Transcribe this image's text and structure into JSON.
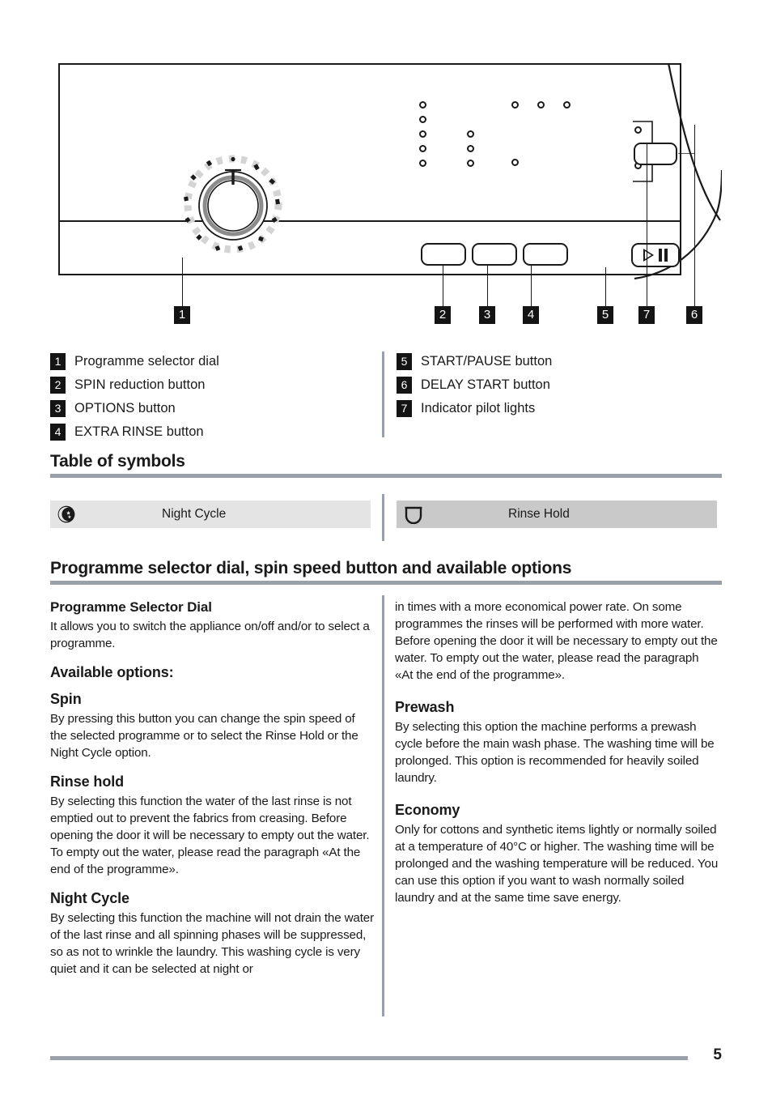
{
  "diagram": {
    "callouts": [
      {
        "num": "1"
      },
      {
        "num": "2"
      },
      {
        "num": "3"
      },
      {
        "num": "4"
      },
      {
        "num": "5"
      },
      {
        "num": "7"
      },
      {
        "num": "6"
      }
    ],
    "icons": {
      "dial": "programme-selector-dial-icon",
      "start_pause": "play-pause-icon",
      "delay_start": "delay-start-button-icon",
      "indicator_lights": "indicator-pilot-lights-icon"
    }
  },
  "legend": {
    "left": [
      {
        "num": "1",
        "label": "Programme selector dial"
      },
      {
        "num": "2",
        "label": "SPIN reduction button"
      },
      {
        "num": "3",
        "label": "OPTIONS button"
      },
      {
        "num": "4",
        "label": "EXTRA RINSE button"
      }
    ],
    "right": [
      {
        "num": "5",
        "label": "START/PAUSE button"
      },
      {
        "num": "6",
        "label": "DELAY START button"
      },
      {
        "num": "7",
        "label": "Indicator pilot lights"
      }
    ]
  },
  "symbols_section": {
    "heading": "Table of symbols",
    "items": [
      {
        "icon": "night-cycle-moon-stars-icon",
        "label": "Night Cycle"
      },
      {
        "icon": "rinse-hold-basin-icon",
        "label": "Rinse Hold"
      }
    ]
  },
  "options_section": {
    "heading": "Programme selector dial, spin speed button and available options",
    "left_column": {
      "h_dial": "Programme Selector Dial",
      "p_dial": "It allows you to switch the appliance on/off and/or to select a programme.",
      "h_available": "Available options:",
      "h_spin": "Spin",
      "p_spin": "By pressing this button you can change the spin speed of the selected programme or to select the Rinse Hold or the Night Cycle option.",
      "h_rinse": "Rinse hold",
      "p_rinse": "By selecting this function the water of the last rinse is not emptied out to prevent the fabrics from creasing. Before opening the door it will be necessary to empty out the water. To empty out the water, please read the paragraph «At the end of the programme».",
      "h_night": "Night Cycle",
      "p_night": "By selecting this function the machine will not drain the water of the last rinse and all spinning phases will be suppressed, so as not to wrinkle the laundry. This washing cycle is very quiet and it can be selected at night or"
    },
    "right_column": {
      "p_continued": "in times with a more economical power rate. On some programmes the rinses will be performed with more water. Before opening the door it will be necessary to empty out the water. To empty out the water, please read the paragraph «At the end of the programme».",
      "h_prewash": "Prewash",
      "p_prewash": "By selecting this option the machine performs a prewash cycle before the main wash phase. The washing time will be prolonged. This option is recommended for heavily soiled laundry.",
      "h_economy": "Economy",
      "p_economy": "Only for cottons and synthetic items lightly or normally soiled at a temperature of 40°C or higher. The washing time will be prolonged and the washing temperature will be reduced. You can use this option if you want to wash normally soiled laundry and at the same time save energy."
    }
  },
  "footer": {
    "page_number": "5"
  },
  "colors": {
    "rule": "#9aa0aa",
    "chip_bg": "#141414",
    "ink": "#1a1a1a",
    "symbol_row_light": "#e4e4e4",
    "symbol_row_dark": "#c9c9c9"
  }
}
